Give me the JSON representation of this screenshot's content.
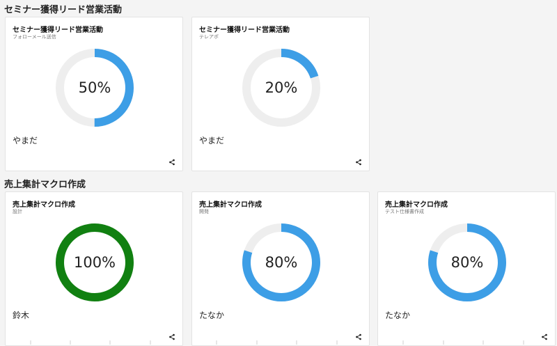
{
  "sections": [
    {
      "title": "セミナー獲得リード営業活動",
      "cards": [
        {
          "title": "セミナー獲得リード営業活動",
          "subtitle": "フォローメール送信",
          "progress": 50,
          "progress_label": "50%",
          "owner": "やまだ",
          "color": "#3d9ee6",
          "share_icon": "share-icon"
        },
        {
          "title": "セミナー獲得リード営業活動",
          "subtitle": "テレアポ",
          "progress": 20,
          "progress_label": "20%",
          "owner": "やまだ",
          "color": "#3d9ee6",
          "share_icon": "share-icon"
        }
      ]
    },
    {
      "title": "売上集計マクロ作成",
      "cards": [
        {
          "title": "売上集計マクロ作成",
          "subtitle": "設計",
          "progress": 100,
          "progress_label": "100%",
          "owner": "鈴木",
          "color": "#118011",
          "share_icon": "share-icon"
        },
        {
          "title": "売上集計マクロ作成",
          "subtitle": "開発",
          "progress": 80,
          "progress_label": "80%",
          "owner": "たなか",
          "color": "#3d9ee6",
          "share_icon": "share-icon"
        },
        {
          "title": "売上集計マクロ作成",
          "subtitle": "テスト仕様書作成",
          "progress": 80,
          "progress_label": "80%",
          "owner": "たなか",
          "color": "#3d9ee6",
          "share_icon": "share-icon"
        }
      ]
    }
  ],
  "colors": {
    "track": "#eeeeee",
    "background": "#f4f4f4",
    "card": "#ffffff"
  }
}
